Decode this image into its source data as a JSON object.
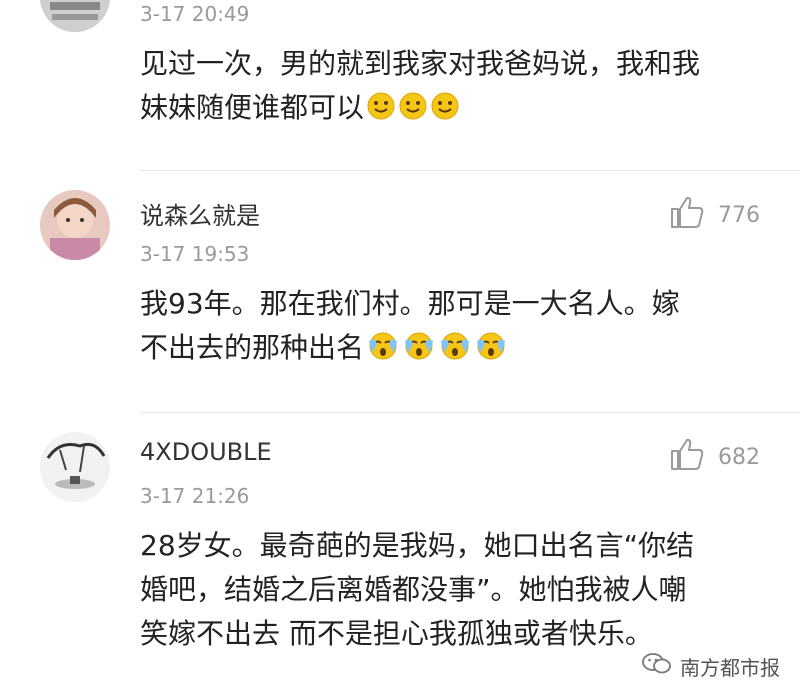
{
  "comments": [
    {
      "username": "",
      "time": "3-17 20:49",
      "text_lines": [
        "见过一次，男的就到我家对我爸妈说，我和我",
        "妹妹随便谁都可以"
      ],
      "emoji": "smile-emoji",
      "emoji_count": 3
    },
    {
      "username": "说森么就是",
      "time": "3-17 19:53",
      "likes": "776",
      "text_lines": [
        "我93年。那在我们村。那可是一大名人。嫁",
        "不出去的那种出名"
      ],
      "emoji": "crying-emoji",
      "emoji_count": 4
    },
    {
      "username": "4XDOUBLE",
      "time": "3-17 21:26",
      "likes": "682",
      "text_lines": [
        "28岁女。最奇葩的是我妈，她口出名言“你结",
        "婚吧，结婚之后离婚都没事”。她怕我被人嘲",
        "笑嫁不出去 而不是担心我孤独或者快乐。"
      ]
    }
  ],
  "watermark": "南方都市报",
  "colors": {
    "text": "#222222",
    "meta": "#9a9a9a",
    "emoji": "#f5c518"
  }
}
